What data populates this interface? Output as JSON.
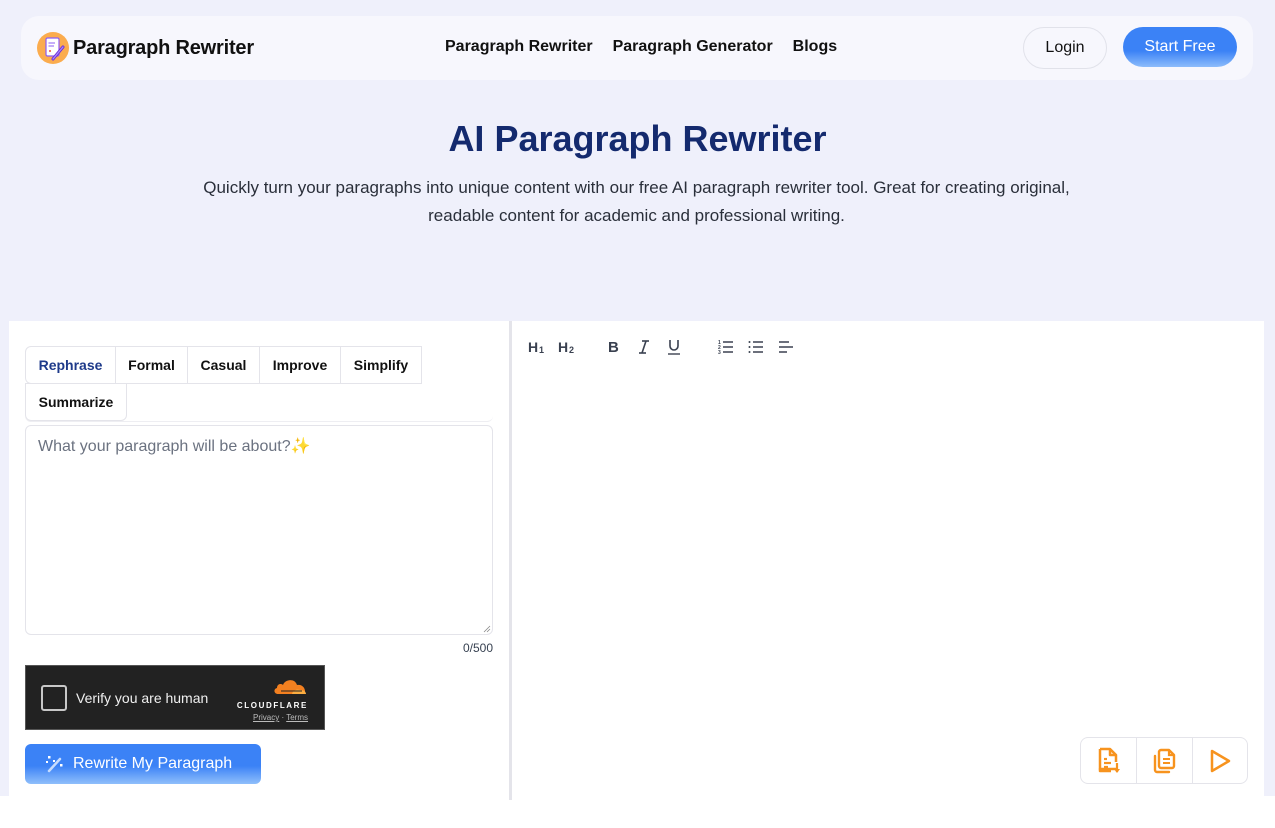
{
  "header": {
    "brand_name": "Paragraph Rewriter",
    "logo_icon": "document-pencil-logo",
    "nav_links": [
      "Paragraph Rewriter",
      "Paragraph Generator",
      "Blogs"
    ],
    "login_label": "Login",
    "start_label": "Start Free"
  },
  "hero": {
    "title": "AI Paragraph Rewriter",
    "subtitle": "Quickly turn your paragraphs into unique content with our free AI paragraph rewriter tool. Great for creating original, readable content for academic and professional writing."
  },
  "editor": {
    "tabs": [
      {
        "label": "Rephrase",
        "active": true
      },
      {
        "label": "Formal",
        "active": false
      },
      {
        "label": "Casual",
        "active": false
      },
      {
        "label": "Improve",
        "active": false
      },
      {
        "label": "Simplify",
        "active": false
      },
      {
        "label": "Summarize",
        "active": false
      }
    ],
    "input_value": "",
    "input_placeholder": "What your paragraph will be about?✨",
    "char_counter": "0/500",
    "captcha": {
      "label": "Verify you are human",
      "provider": "CLOUDFLARE",
      "privacy": "Privacy",
      "separator": "·",
      "terms": "Terms"
    },
    "submit_label": "Rewrite My Paragraph",
    "submit_icon": "magic-wand-icon"
  },
  "output": {
    "toolbar": [
      "heading-1",
      "heading-2",
      "bold",
      "italic",
      "underline",
      "ordered-list",
      "bullet-list",
      "align-left"
    ],
    "content": "",
    "actions": [
      "export-document-icon",
      "copy-icon",
      "play-icon"
    ]
  },
  "colors": {
    "primary": "#3b82f6",
    "heading": "#142a6e",
    "accent_orange": "#f7931e",
    "background": "#eff0fb"
  }
}
